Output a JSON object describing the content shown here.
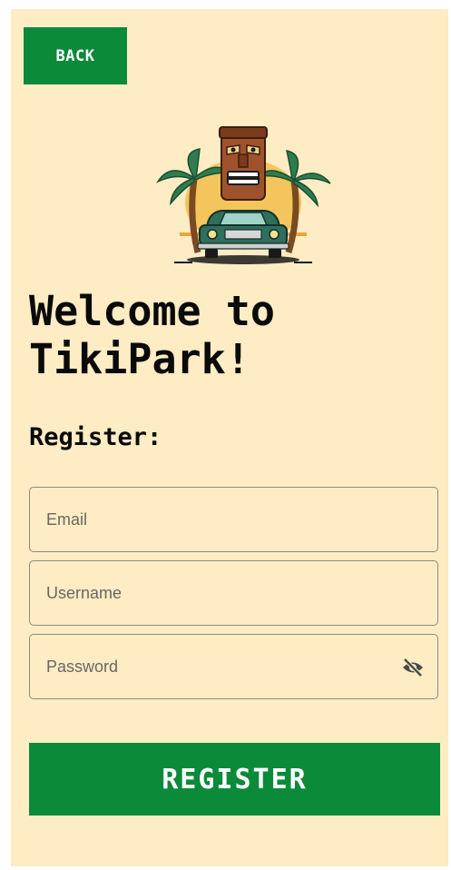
{
  "header": {
    "back_label": "BACK"
  },
  "logo": {
    "icon": "tiki-car-palm-logo"
  },
  "main": {
    "title_line1": "Welcome to",
    "title_line2": "TikiPark!",
    "subtitle": "Register:"
  },
  "form": {
    "email": {
      "value": "",
      "placeholder": "Email"
    },
    "username": {
      "value": "",
      "placeholder": "Username"
    },
    "password": {
      "value": "",
      "placeholder": "Password",
      "toggle_icon": "eye-off-icon"
    },
    "submit_label": "REGISTER"
  },
  "colors": {
    "background": "#fdecc4",
    "accent": "#0b8a3a",
    "text": "#0a0a0a"
  }
}
